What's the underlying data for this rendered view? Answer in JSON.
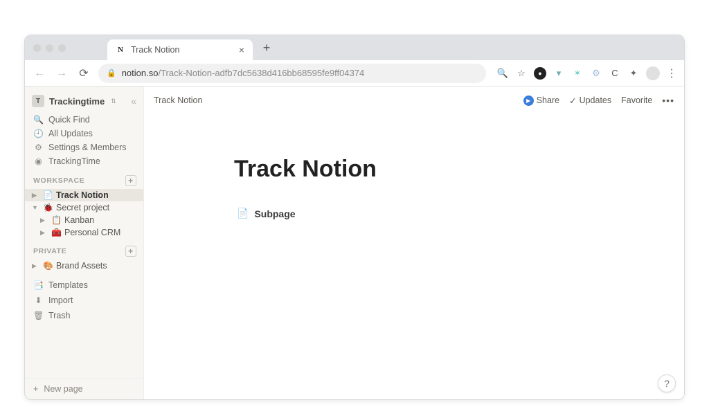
{
  "browser": {
    "tab_title": "Track Notion",
    "url_host": "notion.so",
    "url_path": "/Track-Notion-adfb7dc5638d416bb68595fe9ff04374"
  },
  "workspace": {
    "name": "Trackingtime",
    "badge": "T"
  },
  "sidebar": {
    "quick_find": "Quick Find",
    "all_updates": "All Updates",
    "settings": "Settings & Members",
    "trackingtime": "TrackingTime",
    "sections": {
      "workspace": "WORKSPACE",
      "private": "PRIVATE"
    },
    "pages": {
      "track_notion": "Track Notion",
      "secret_project": "Secret project",
      "kanban": "Kanban",
      "personal_crm": "Personal CRM",
      "brand_assets": "Brand Assets"
    },
    "templates": "Templates",
    "import": "Import",
    "trash": "Trash",
    "new_page": "New page"
  },
  "topbar": {
    "breadcrumb": "Track Notion",
    "share": "Share",
    "updates": "Updates",
    "favorite": "Favorite"
  },
  "page": {
    "title": "Track Notion",
    "subpage": "Subpage"
  },
  "icons": {
    "search": "🔍",
    "clock": "🕘",
    "gear": "⚙",
    "target": "◉",
    "doc": "📄",
    "bug": "🐞",
    "clipboard": "📋",
    "toolbox": "🧰",
    "palette": "🎨",
    "templates": "📑",
    "import": "⬇",
    "trash": "🗑",
    "plus": "+",
    "check": "✓",
    "help": "?"
  }
}
